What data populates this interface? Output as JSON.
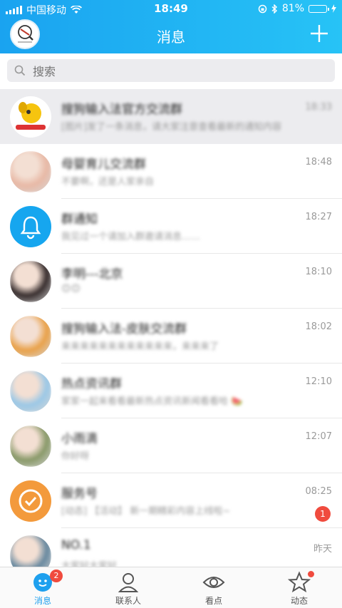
{
  "status_bar": {
    "carrier": "中国移动",
    "time": "18:49",
    "battery_pct": "81%",
    "battery_level": 0.81
  },
  "header": {
    "title": "消息",
    "add_icon": "plus-icon"
  },
  "search": {
    "placeholder": "搜索"
  },
  "conversations": [
    {
      "name": "搜狗输入法官方交流群",
      "preview": "[图片]发了一条消息，请大家注意查看最新的通知内容",
      "time": "18:33",
      "avatar": "dog-logo",
      "color": "#f6c40f"
    },
    {
      "name": "母婴育儿交流群",
      "preview": "不要啊，还是人家亲自",
      "time": "18:48",
      "avatar": "photo-woman",
      "color": "#e8b9a6"
    },
    {
      "name": "群通知",
      "preview": "我见过一个请加入群邀请消息……",
      "time": "18:27",
      "avatar": "bell-icon",
      "color": "#16a6ef"
    },
    {
      "name": "李明---北京",
      "preview": "😊😊",
      "time": "18:10",
      "avatar": "photo-girl",
      "color": "#3a3030"
    },
    {
      "name": "搜狗输入法-皮肤交流群",
      "preview": "来来来来来来来来来来来来，来来来了",
      "time": "18:02",
      "avatar": "colorful-logo",
      "color": "#e9a24b"
    },
    {
      "name": "热点资讯群",
      "preview": "家家一起来看看最新热点资讯新闻看看哈 🍉",
      "time": "12:10",
      "avatar": "cartoon-couple",
      "color": "#9cc8e6"
    },
    {
      "name": "小雨滴",
      "preview": "你好呀",
      "time": "12:07",
      "avatar": "photo-outdoor",
      "color": "#8a9a6a"
    },
    {
      "name": "服务号",
      "preview": "[动态] 【活动】 新一期精彩内容上线啦~",
      "time": "08:25",
      "avatar": "orange-check-icon",
      "color": "#f39a3c",
      "unread": "1"
    },
    {
      "name": "NO.1",
      "preview": "大家好大家好",
      "time": "昨天",
      "avatar": "photo-collage",
      "color": "#6a8aa0"
    }
  ],
  "tabs": [
    {
      "label": "消息",
      "icon": "chat-bubble-icon",
      "badge": "2",
      "active": true
    },
    {
      "label": "联系人",
      "icon": "contacts-icon"
    },
    {
      "label": "看点",
      "icon": "eye-icon"
    },
    {
      "label": "动态",
      "icon": "star-icon",
      "dot": true
    }
  ],
  "colors": {
    "header_start": "#1aa3f0",
    "header_end": "#27c3f6",
    "accent": "#1ea0ee",
    "badge": "#f04b3e"
  }
}
